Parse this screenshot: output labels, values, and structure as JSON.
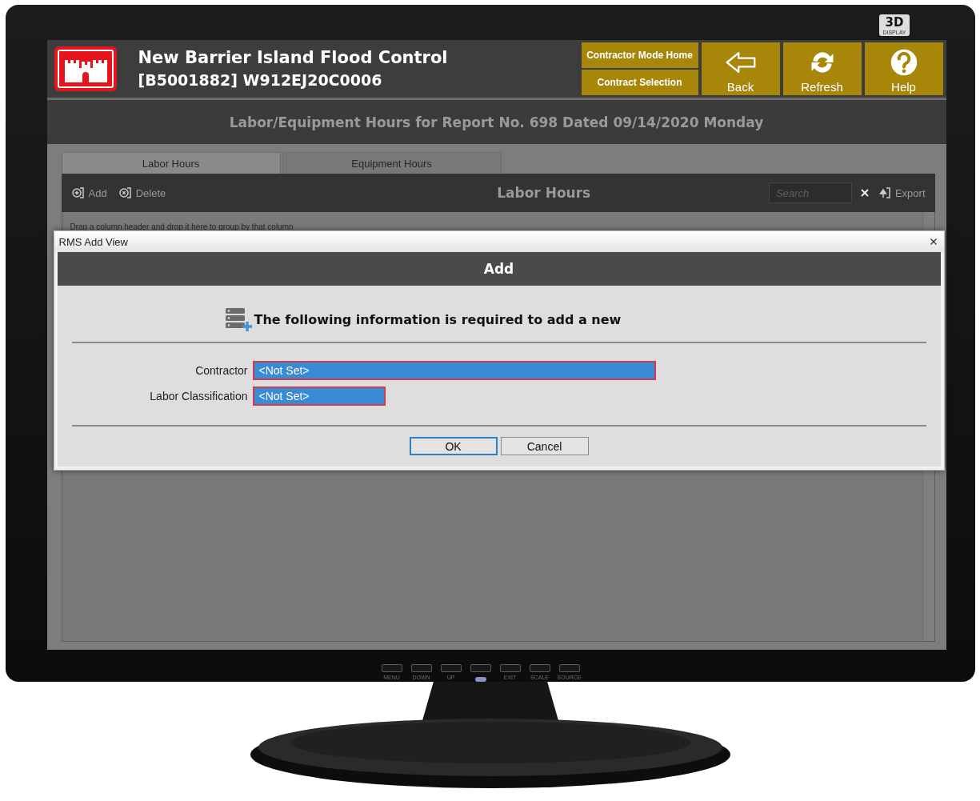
{
  "monitor": {
    "badge": "3D",
    "badge_sub": "DISPLAY",
    "keys": [
      {
        "kind": "key",
        "label": "MENU"
      },
      {
        "kind": "key",
        "label": "DOWN"
      },
      {
        "kind": "key",
        "label": "UP"
      },
      {
        "kind": "power"
      },
      {
        "kind": "key",
        "label": "EXIT"
      },
      {
        "kind": "key",
        "label": "SCALE"
      },
      {
        "kind": "key",
        "label": "SOURCE"
      }
    ]
  },
  "header": {
    "title": "New Barrier Island Flood Control",
    "subtitle": "[B5001882] W912EJ20C0006",
    "nav": [
      {
        "kind": "small",
        "label": "Contractor Mode Home"
      },
      {
        "kind": "small",
        "label": "Contract Selection"
      },
      {
        "kind": "back",
        "label": "Back"
      },
      {
        "kind": "refresh",
        "label": "Refresh"
      },
      {
        "kind": "help",
        "label": "Help"
      }
    ]
  },
  "page_title": "Labor/Equipment Hours for Report No. 698 Dated 09/14/2020 Monday",
  "tabs": [
    {
      "label": "Labor Hours",
      "selected": true
    },
    {
      "label": "Equipment Hours",
      "selected": false
    }
  ],
  "toolbar": {
    "actions": [
      {
        "kind": "add",
        "label": "Add"
      },
      {
        "kind": "delete",
        "label": "Delete"
      }
    ],
    "title": "Labor Hours",
    "search": {
      "placeholder": "Search"
    },
    "export": "Export"
  },
  "group_hint": "Drag a column header and drop it here to group by that column",
  "dialog": {
    "window_title": "RMS Add View",
    "header": "Add",
    "message": "The following information is required to add a new",
    "fields": [
      {
        "label": "Contractor",
        "value": "<Not Set>",
        "invalid": true,
        "wide": true
      },
      {
        "label": "Labor Classification",
        "value": "<Not Set>",
        "invalid": true,
        "wide": false
      }
    ],
    "buttons": [
      {
        "label": "OK",
        "default": true
      },
      {
        "label": "Cancel",
        "default": false
      }
    ]
  }
}
